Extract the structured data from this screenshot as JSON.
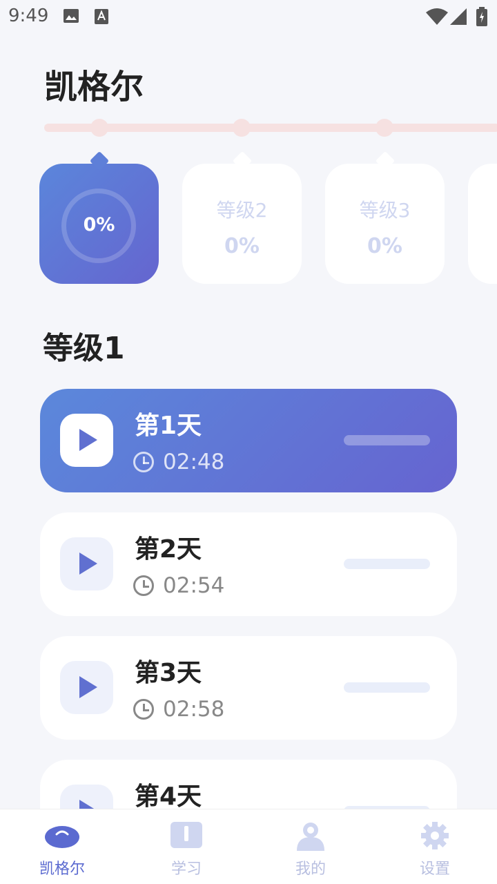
{
  "status_bar": {
    "time": "9:49"
  },
  "page_title": "凯格尔",
  "levels": [
    {
      "name": "",
      "percent": "0%",
      "active": true
    },
    {
      "name": "等级2",
      "percent": "0%",
      "active": false
    },
    {
      "name": "等级3",
      "percent": "0%",
      "active": false
    }
  ],
  "section_title": "等级1",
  "lessons": [
    {
      "title": "第1天",
      "duration": "02:48",
      "progress": 0,
      "active": true
    },
    {
      "title": "第2天",
      "duration": "02:54",
      "progress": 0,
      "active": false
    },
    {
      "title": "第3天",
      "duration": "02:58",
      "progress": 0,
      "active": false
    },
    {
      "title": "第4天",
      "duration": "",
      "progress": 0,
      "active": false
    }
  ],
  "tabs": [
    {
      "label": "凯格尔",
      "icon": "kegel-icon",
      "active": true
    },
    {
      "label": "学习",
      "icon": "book-icon",
      "active": false
    },
    {
      "label": "我的",
      "icon": "profile-icon",
      "active": false
    },
    {
      "label": "设置",
      "icon": "gear-icon",
      "active": false
    }
  ],
  "colors": {
    "accent": "#6070d0",
    "gradient_start": "#5b88db",
    "gradient_end": "#6664d0",
    "track": "#f6e1e1",
    "inactive_tab": "#b8bfe0"
  }
}
